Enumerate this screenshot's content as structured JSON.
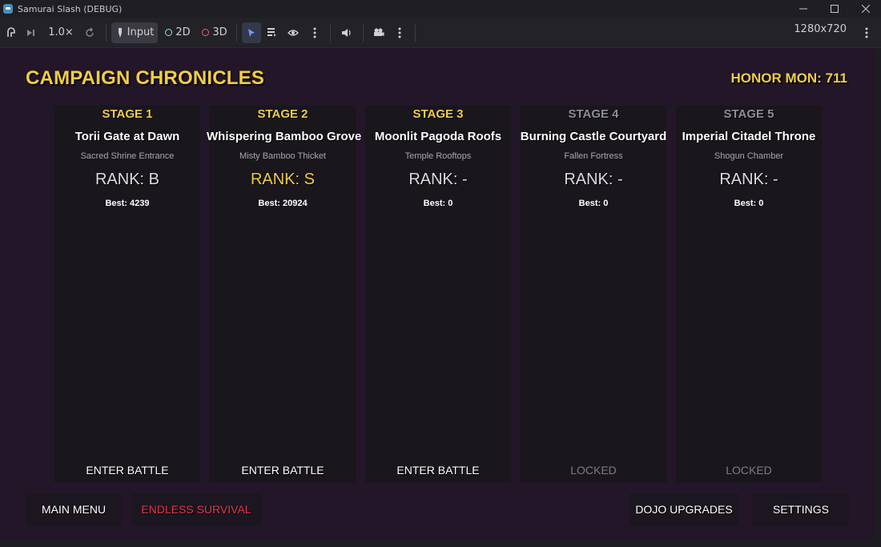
{
  "window": {
    "title": "Samurai Slash (DEBUG)",
    "controls": [
      "–",
      "☐",
      "✕"
    ]
  },
  "toolbar": {
    "speed": "1.0×",
    "input_label": "Input",
    "mode_2d": "2D",
    "mode_3d": "3D",
    "resolution": "1280x720",
    "icons": [
      "remote-debug-icon",
      "step-frame-icon",
      "reset-speed-icon",
      "input-pointer-icon",
      "select-arrow-icon",
      "list-select-icon",
      "visibility-eye-icon",
      "more-menu-icon",
      "audio-mute-icon",
      "camera-icon"
    ]
  },
  "game": {
    "title": "CAMPAIGN CHRONICLES",
    "honor": "HONOR MON: 711",
    "colors": {
      "gold": "#f0cd44",
      "red": "#e23a52",
      "background": "#221628",
      "panel": "#19161c"
    },
    "stages": [
      {
        "label": "STAGE 1",
        "name": "Torii Gate at Dawn",
        "subtitle": "Sacred Shrine Entrance",
        "rank": "RANK: B",
        "best": "Best: 4239",
        "button": "ENTER BATTLE",
        "locked": false
      },
      {
        "label": "STAGE 2",
        "name": "Whispering Bamboo Grove",
        "subtitle": "Misty Bamboo Thicket",
        "rank": "RANK: S",
        "best": "Best: 20924",
        "button": "ENTER BATTLE",
        "locked": false
      },
      {
        "label": "STAGE 3",
        "name": "Moonlit Pagoda Roofs",
        "subtitle": "Temple Rooftops",
        "rank": "RANK: -",
        "best": "Best: 0",
        "button": "ENTER BATTLE",
        "locked": false
      },
      {
        "label": "STAGE 4",
        "name": "Burning Castle Courtyard",
        "subtitle": "Fallen Fortress",
        "rank": "RANK: -",
        "best": "Best: 0",
        "button": "LOCKED",
        "locked": true
      },
      {
        "label": "STAGE 5",
        "name": "Imperial Citadel Throne",
        "subtitle": "Shogun Chamber",
        "rank": "RANK: -",
        "best": "Best: 0",
        "button": "LOCKED",
        "locked": true
      }
    ],
    "bottom": {
      "main_menu": "MAIN MENU",
      "endless": "ENDLESS SURVIVAL",
      "dojo": "DOJO UPGRADES",
      "settings": "SETTINGS"
    }
  }
}
